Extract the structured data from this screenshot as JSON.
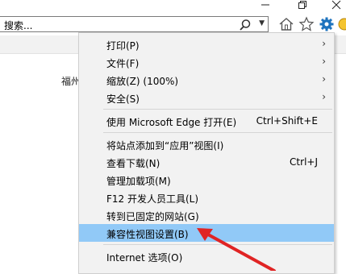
{
  "address": {
    "search_text": "搜索..."
  },
  "page": {
    "text": "福州"
  },
  "menu": {
    "items": [
      {
        "label": "打印(P)",
        "shortcut": "",
        "submenu": true
      },
      {
        "label": "文件(F)",
        "shortcut": "",
        "submenu": true
      },
      {
        "label": "缩放(Z) (100%)",
        "shortcut": "",
        "submenu": true
      },
      {
        "label": "安全(S)",
        "shortcut": "",
        "submenu": true
      },
      {
        "label": "使用 Microsoft Edge 打开(E)",
        "shortcut": "Ctrl+Shift+E",
        "submenu": false
      },
      {
        "label": "将站点添加到“应用”视图(I)",
        "shortcut": "",
        "submenu": false
      },
      {
        "label": "查看下载(N)",
        "shortcut": "Ctrl+J",
        "submenu": false
      },
      {
        "label": "管理加载项(M)",
        "shortcut": "",
        "submenu": false
      },
      {
        "label": "F12 开发人员工具(L)",
        "shortcut": "",
        "submenu": false
      },
      {
        "label": "转到已固定的网站(G)",
        "shortcut": "",
        "submenu": false
      },
      {
        "label": "兼容性视图设置(B)",
        "shortcut": "",
        "submenu": false,
        "highlighted": true
      },
      {
        "label": "Internet 选项(O)",
        "shortcut": "",
        "submenu": false
      }
    ],
    "arrow_glyph": "›"
  },
  "colors": {
    "highlight": "#91c9f7",
    "annotation_arrow": "#e02424",
    "gear": "#1e73be"
  }
}
